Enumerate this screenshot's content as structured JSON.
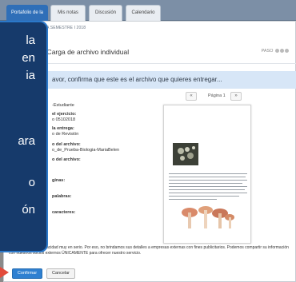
{
  "tabs": [
    {
      "label": "Portafolio de la clase",
      "active": true
    },
    {
      "label": "Mis notas",
      "active": false
    },
    {
      "label": "Discusión",
      "active": false
    },
    {
      "label": "Calendario",
      "active": false
    }
  ],
  "breadcrumb": "INICIO > BIOLOGÍA SEMESTRE I 2018",
  "page_title": "r: Carga de archivo individual",
  "step_label": "PASO",
  "confirm_message": "avor, confirma que este es el archivo que quieres entregar...",
  "details": {
    "student": "-Estudiante",
    "exercise_label": "el ejercicio:",
    "exercise_value": "o 05102018",
    "due_label": "la entrega:",
    "due_value": "o de Revisión",
    "file_label": "o del archivo:",
    "file_value": "o_de_Prueba-Biologia-MariaBelen",
    "file2_label": "o del archivo:",
    "pages_label": "ginas:",
    "words_label": "palabras:",
    "chars_label": "caracteres:"
  },
  "pager": {
    "prev": "«",
    "label": "Página 1",
    "next": "»"
  },
  "bubble_lines": [
    "la",
    "en",
    "ia",
    "ara",
    "o",
    "ón"
  ],
  "privacy_text": "Nos tomamos su privacidad muy en serio. Por eso, no brindamos sus detalles a empresas externas con fines publicitarios. Podemos compartir su información con nuestros socios externos ÚNICAMENTE para ofrecer nuestro servicio.",
  "buttons": {
    "confirm": "Confirmar",
    "cancel": "Cancelar"
  },
  "colors": {
    "accent": "#2f80d1",
    "bubble": "#163a6b",
    "arrow": "#e24b3b",
    "band": "#d7e6f7"
  }
}
